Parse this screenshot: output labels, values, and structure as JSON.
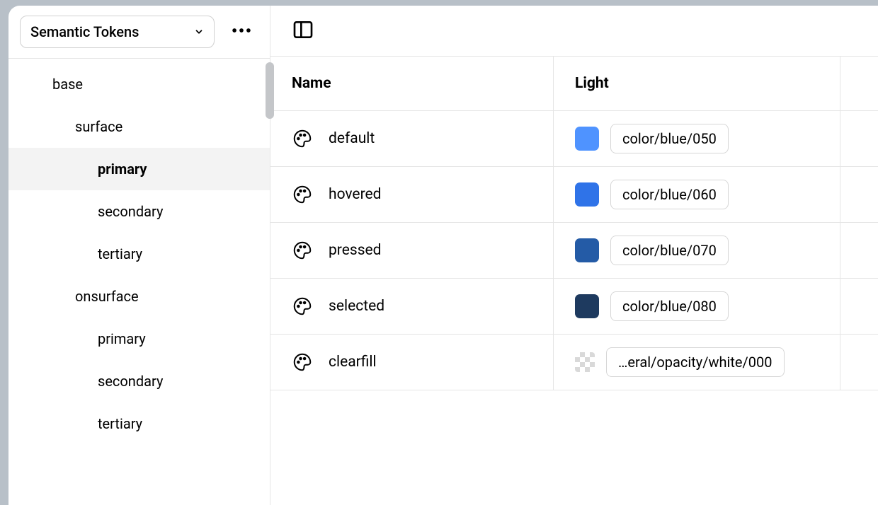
{
  "sidebar": {
    "dropdown_label": "Semantic Tokens",
    "tree": [
      {
        "label": "base",
        "level": 0,
        "selected": false
      },
      {
        "label": "surface",
        "level": 1,
        "selected": false
      },
      {
        "label": "primary",
        "level": 2,
        "selected": true
      },
      {
        "label": "secondary",
        "level": 2,
        "selected": false
      },
      {
        "label": "tertiary",
        "level": 2,
        "selected": false
      },
      {
        "label": "onsurface",
        "level": 1,
        "selected": false
      },
      {
        "label": "primary",
        "level": 2,
        "selected": false
      },
      {
        "label": "secondary",
        "level": 2,
        "selected": false
      },
      {
        "label": "tertiary",
        "level": 2,
        "selected": false
      }
    ]
  },
  "table": {
    "headers": {
      "name": "Name",
      "light": "Light"
    },
    "rows": [
      {
        "name": "default",
        "token": "color/blue/050",
        "swatch": "#4F93FF",
        "checker": false
      },
      {
        "name": "hovered",
        "token": "color/blue/060",
        "swatch": "#2F73E8",
        "checker": false
      },
      {
        "name": "pressed",
        "token": "color/blue/070",
        "swatch": "#245BA6",
        "checker": false
      },
      {
        "name": "selected",
        "token": "color/blue/080",
        "swatch": "#1E3A5F",
        "checker": false
      },
      {
        "name": "clearfill",
        "token": "…eral/opacity/white/000",
        "swatch": "",
        "checker": true
      }
    ]
  }
}
